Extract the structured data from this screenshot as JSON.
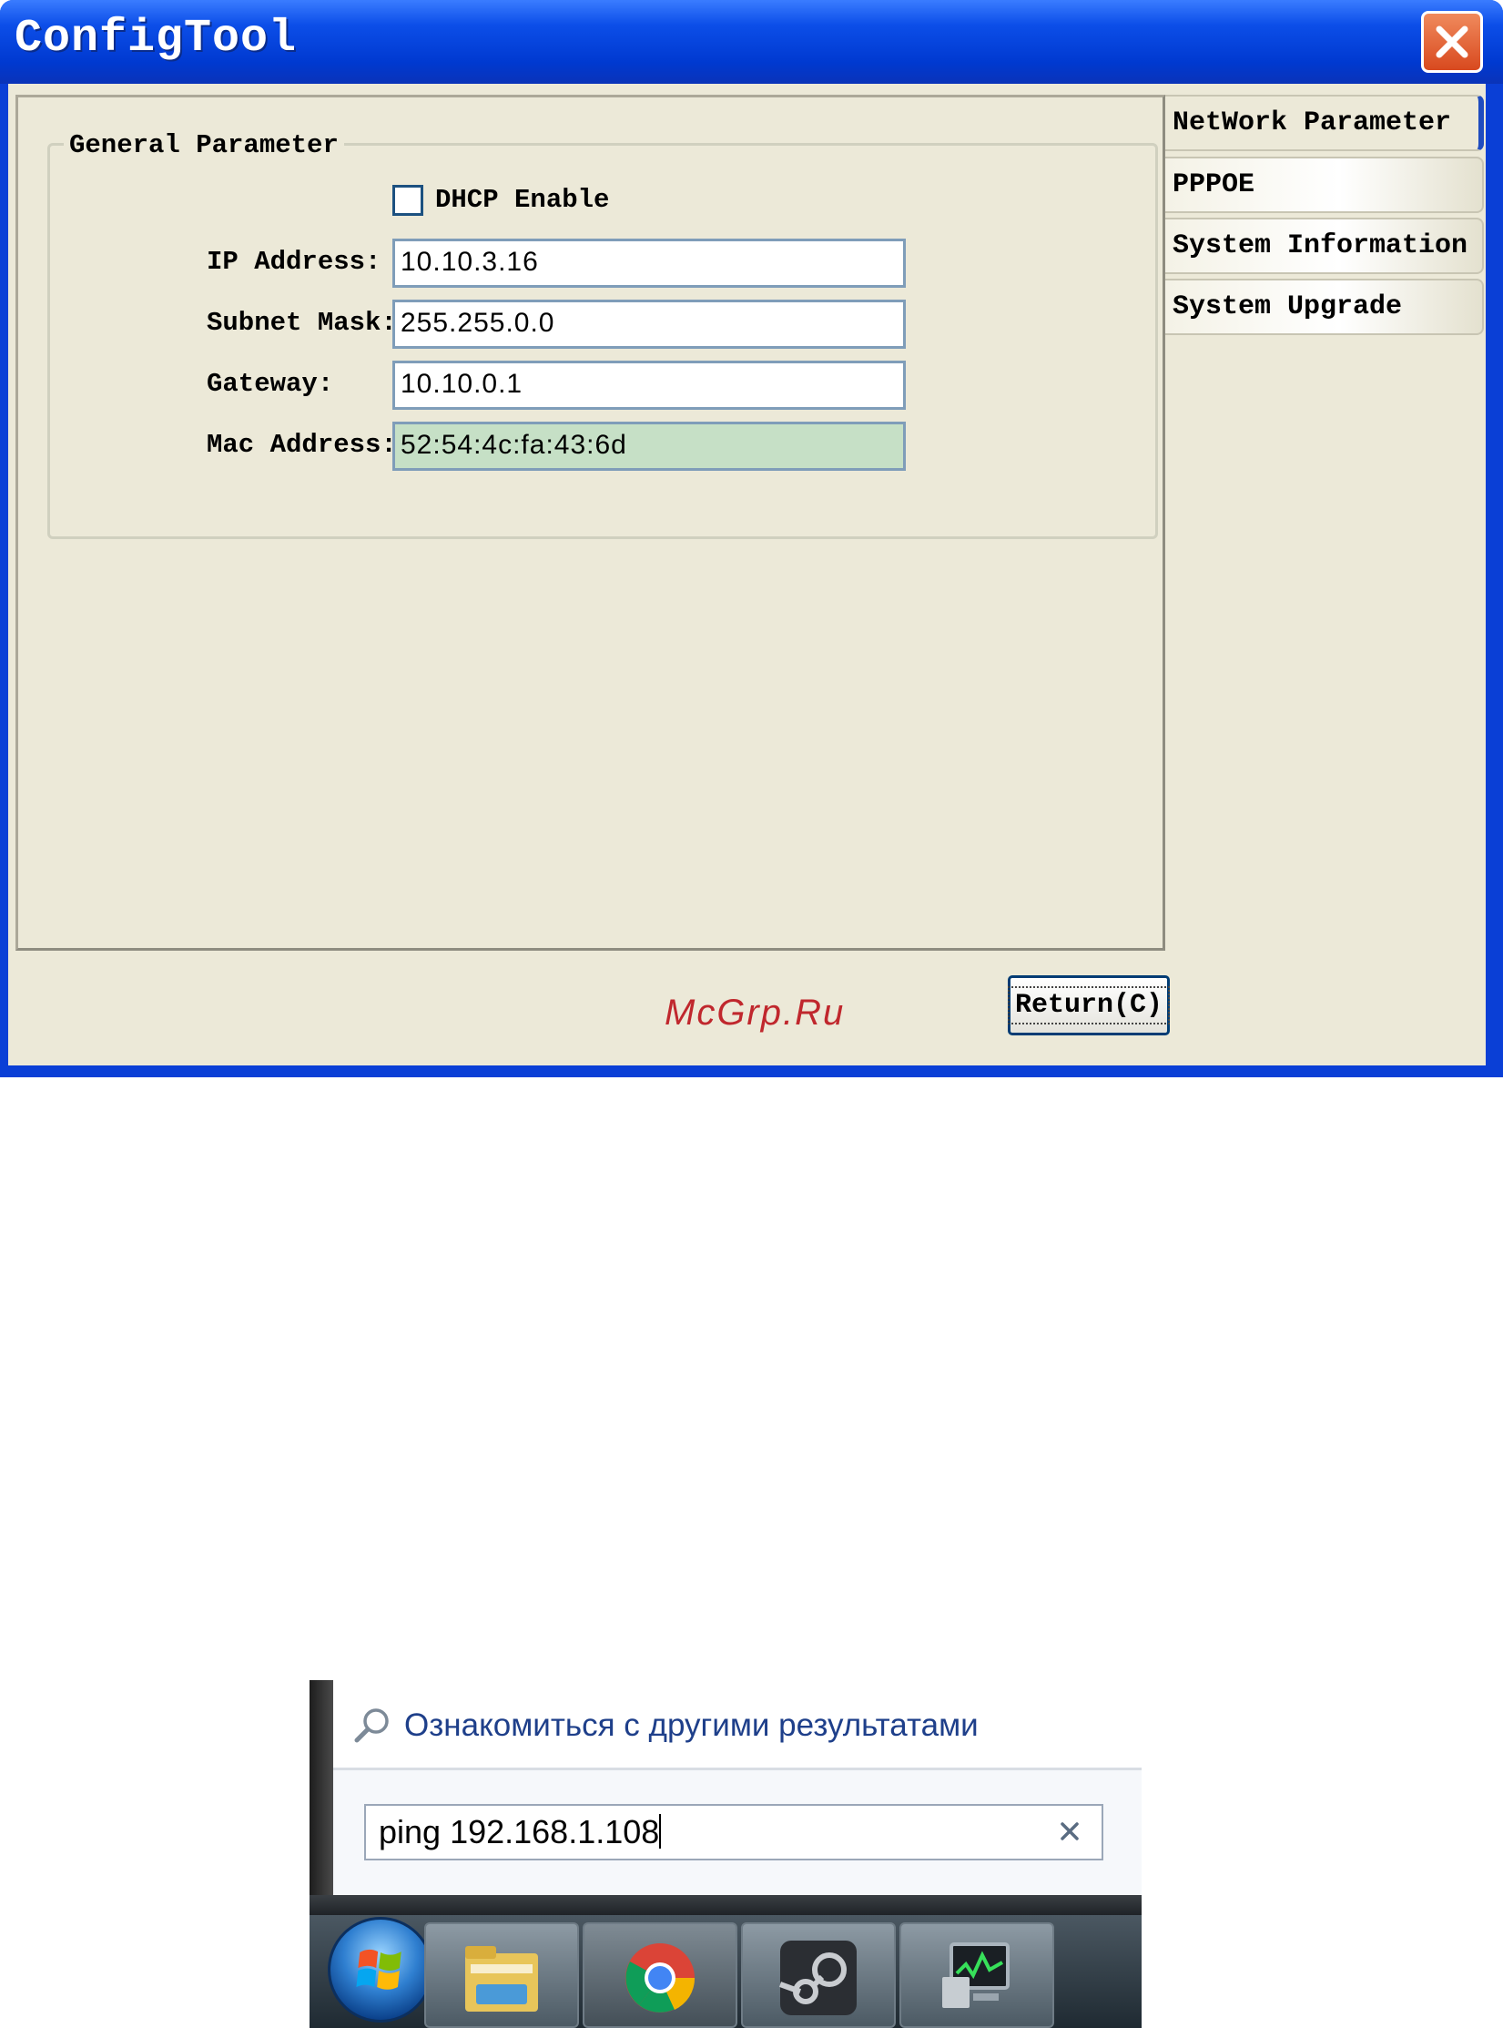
{
  "window": {
    "title": "ConfigTool",
    "group_title": "General Parameter",
    "dhcp_label": "DHCP Enable",
    "dhcp_checked": false,
    "fields": {
      "ip_label": "IP Address:",
      "ip_value": "10.10.3.16",
      "subnet_label": "Subnet Mask:",
      "subnet_value": "255.255.0.0",
      "gateway_label": "Gateway:",
      "gateway_value": "10.10.0.1",
      "mac_label": "Mac Address:",
      "mac_value": "52:54:4c:fa:43:6d"
    },
    "tabs": [
      "NetWork Parameter",
      "PPPOE",
      "System Information",
      "System Upgrade"
    ],
    "return_label": "Return(C)",
    "watermark": "McGrp.Ru",
    "colors": {
      "titlebar": "#0039d0",
      "client": "#ece9d8",
      "mac_bg": "#c6e0c6",
      "active_tab_marker": "#1f4cbf"
    }
  },
  "start_search": {
    "results_link": "Ознакомиться с другими результатами",
    "query": "ping 192.168.1.108",
    "icons": [
      "search-icon",
      "clear-icon",
      "windows-orb-icon",
      "file-explorer-icon",
      "chrome-icon",
      "steam-icon",
      "network-monitor-icon"
    ]
  }
}
